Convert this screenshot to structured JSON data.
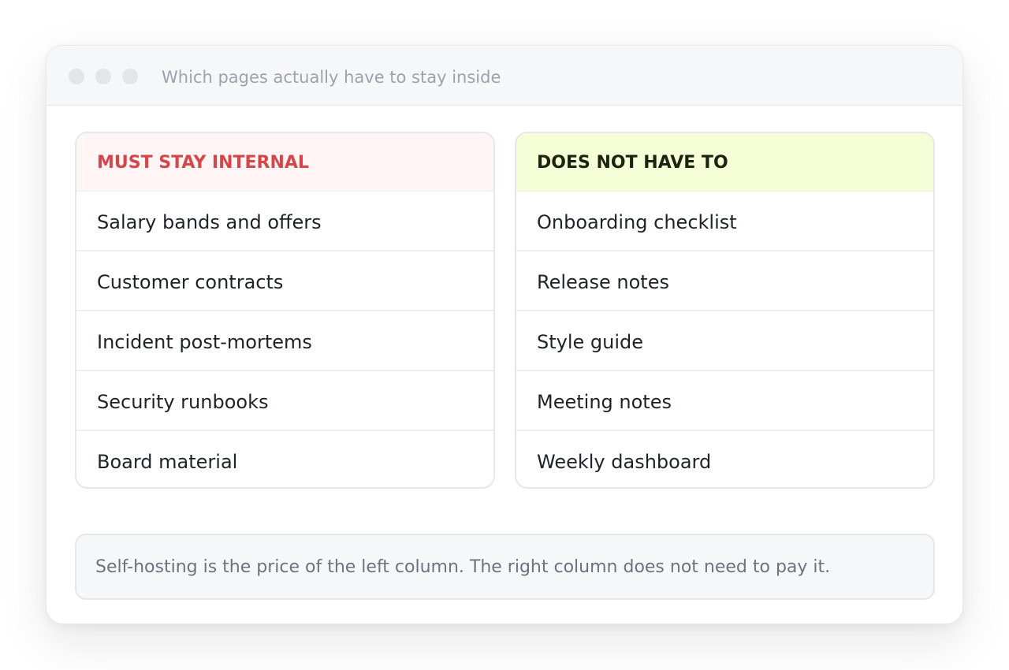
{
  "window": {
    "title": "Which pages actually have to stay inside"
  },
  "columns": {
    "must_stay_internal": {
      "heading": "MUST STAY INTERNAL",
      "accent_color": "#d6454a",
      "items": [
        "Salary bands and offers",
        "Customer contracts",
        "Incident post-mortems",
        "Security runbooks",
        "Board material"
      ]
    },
    "does_not_have_to": {
      "heading": "DOES NOT HAVE TO",
      "accent_color": "#f5fed6",
      "items": [
        "Onboarding checklist",
        "Release notes",
        "Style guide",
        "Meeting notes",
        "Weekly dashboard"
      ]
    }
  },
  "footer_note": "Self-hosting is the price of the left column. The right column does not need to pay it."
}
